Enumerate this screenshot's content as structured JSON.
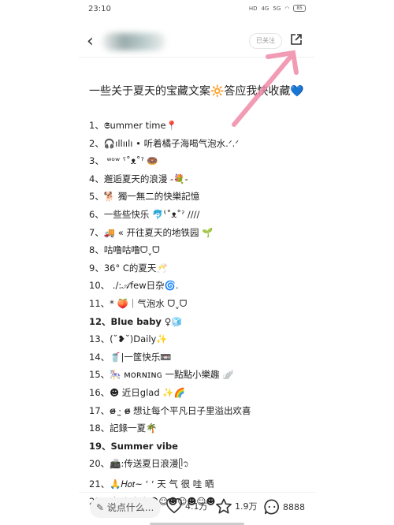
{
  "status": {
    "time": "23:10",
    "network": [
      "HD",
      "4G",
      "5G"
    ],
    "battery": "85"
  },
  "nav": {
    "back_icon": "chevron-left-icon",
    "follow_label": "已关注",
    "share_icon": "share-external-icon"
  },
  "post": {
    "title": "一些关于夏天的宝藏文案🔆答应我快收藏💙",
    "items": [
      "1、𝕾ummer time📍",
      "2、🎧ıllıılı • 听着橘子海喝气泡水.ᐟ.ᐟ",
      "3、 ʷᵒʷ ˁ˚ᴥ˚ˀ 🍩",
      "4、邂逅夏天的浪漫 -💐-",
      "5、🐕 獨一無二的快樂記憶",
      "6、一些些快乐 🐬ˁ˚ᴥ˚ˀ ////",
      "7、🚚 « 开往夏天的地铁园 🌱",
      "8、咕噜咕噜ᗜˬᗜ",
      "9、36° C的夏天🥂",
      "10、 ./:𝒜few日杂🌀.",
      "11、* 🍑｜气泡水 ᗜˬᗜ",
      "12、Blue baby ♀🧊",
      "13、(˘❥˘)Daily✨",
      "14、🥤|一筐快乐📼",
      "15、🎠 ᴍᴏʀɴɪɴɢ 一點點小樂趣 🪽",
      "16、☻ 近日glad ✨🌈",
      "17、ɞ̴̶̷ ·̫ ɞ̴̶̷ 想让每个平凡日子里溢出欢喜",
      "18、記錄一夏🌴",
      "19、Summer vibe",
      "20、📠:传送夏日浪漫ᥫ᭡",
      "21、🙏𝐻𝑜𝑡~ ʻ ʻ 天 气 很 哇 晒",
      "22、🛵☺☻☺☻☺☻☺☻☺☻"
    ],
    "bold_items": [
      11,
      18
    ]
  },
  "bottom": {
    "comment_placeholder": "✎ 说点什么...",
    "likes": "4.1万",
    "favorites": "1.9万",
    "comments": "8888"
  },
  "annotation_color": "#f08aa8"
}
